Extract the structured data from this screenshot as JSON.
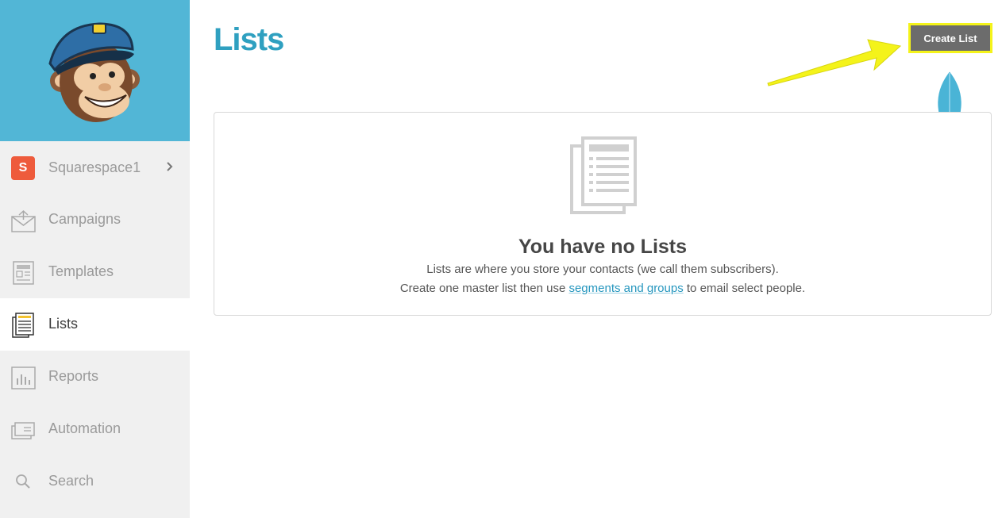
{
  "sidebar": {
    "account": {
      "badge": "S",
      "name": "Squarespace1"
    },
    "items": [
      {
        "label": "Campaigns",
        "icon": "envelope-icon"
      },
      {
        "label": "Templates",
        "icon": "template-icon"
      },
      {
        "label": "Lists",
        "icon": "list-icon",
        "active": true
      },
      {
        "label": "Reports",
        "icon": "bar-chart-icon"
      },
      {
        "label": "Automation",
        "icon": "automation-icon"
      },
      {
        "label": "Search",
        "icon": "search-icon"
      }
    ]
  },
  "header": {
    "title": "Lists",
    "create_button": "Create List"
  },
  "empty_state": {
    "title": "You have no Lists",
    "line1": "Lists are where you store your contacts (we call them subscribers).",
    "line2_before": "Create one master list then use ",
    "line2_link": "segments and groups",
    "line2_after": " to email select people."
  },
  "colors": {
    "brand_blue": "#52b6d6",
    "title_blue": "#2fa0c0",
    "badge_orange": "#ee5b3c",
    "highlight_yellow": "#f4f31a",
    "button_gray": "#6c6c6c"
  }
}
